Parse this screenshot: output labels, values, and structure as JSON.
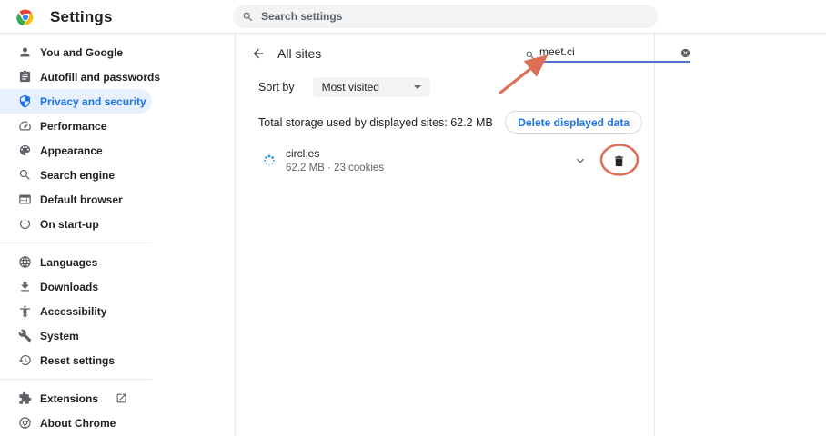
{
  "header": {
    "title": "Settings",
    "search_placeholder": "Search settings"
  },
  "sidebar": {
    "items": [
      {
        "label": "You and Google",
        "icon": "person-icon"
      },
      {
        "label": "Autofill and passwords",
        "icon": "clipboard-icon"
      },
      {
        "label": "Privacy and security",
        "icon": "shield-icon",
        "selected": true
      },
      {
        "label": "Performance",
        "icon": "speedometer-icon"
      },
      {
        "label": "Appearance",
        "icon": "palette-icon"
      },
      {
        "label": "Search engine",
        "icon": "search-icon"
      },
      {
        "label": "Default browser",
        "icon": "browser-window-icon"
      },
      {
        "label": "On start-up",
        "icon": "power-icon"
      },
      {
        "label": "Languages",
        "icon": "globe-icon"
      },
      {
        "label": "Downloads",
        "icon": "download-icon"
      },
      {
        "label": "Accessibility",
        "icon": "accessibility-icon"
      },
      {
        "label": "System",
        "icon": "wrench-icon"
      },
      {
        "label": "Reset settings",
        "icon": "restore-icon"
      },
      {
        "label": "Extensions",
        "icon": "puzzle-icon",
        "trailing_icon": "external-link-icon"
      },
      {
        "label": "About Chrome",
        "icon": "chrome-outline-icon"
      }
    ]
  },
  "content": {
    "page_title": "All sites",
    "site_search": {
      "value": "meet.ci",
      "icons": [
        "search-icon",
        "clear-icon"
      ]
    },
    "sort": {
      "label": "Sort by",
      "selected_option": "Most visited"
    },
    "storage_summary": "Total storage used by displayed sites: 62.2 MB",
    "delete_button_label": "Delete displayed data",
    "sites": [
      {
        "name": "circl.es",
        "details": "62.2 MB · 23 cookies",
        "icons": [
          "site-favicon",
          "chevron-down-icon",
          "trash-icon"
        ]
      }
    ]
  },
  "annotations": {
    "arrow": "points to site search field",
    "circle": "around trash icon of circl.es row"
  },
  "colors": {
    "accent": "#1a73e8",
    "selected_bg": "#e8f0fe",
    "annotation": "#db7056",
    "search_pill_bg": "#f1f3f4"
  }
}
